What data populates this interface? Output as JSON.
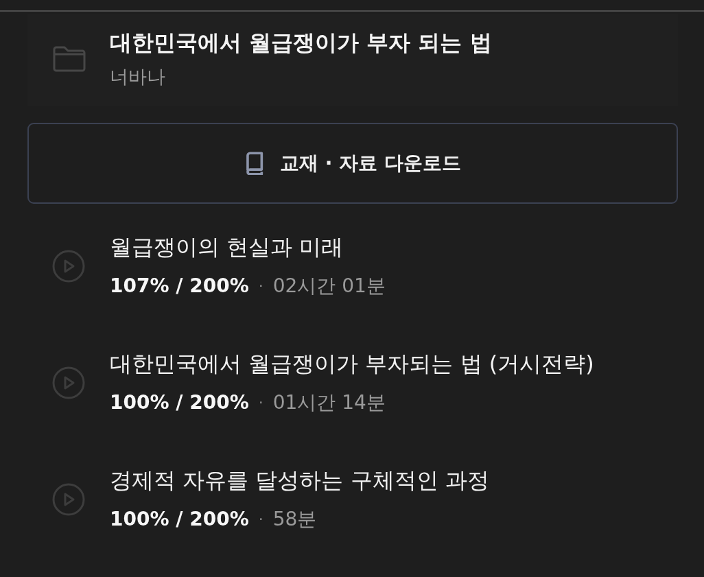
{
  "header": {
    "title": "대한민국에서 월급쟁이가 부자 되는 법",
    "author": "너바나"
  },
  "download_button": {
    "label": "교재 · 자료 다운로드"
  },
  "lectures": [
    {
      "title": "월급쟁이의 현실과 미래",
      "progress": "107% / 200%",
      "separator": "·",
      "duration": "02시간 01분"
    },
    {
      "title": "대한민국에서 월급쟁이가 부자되는 법 (거시전략)",
      "progress": "100% / 200%",
      "separator": "·",
      "duration": "01시간 14분"
    },
    {
      "title": "경제적 자유를 달성하는 구체적인 과정",
      "progress": "100% / 200%",
      "separator": "·",
      "duration": "58분"
    }
  ]
}
